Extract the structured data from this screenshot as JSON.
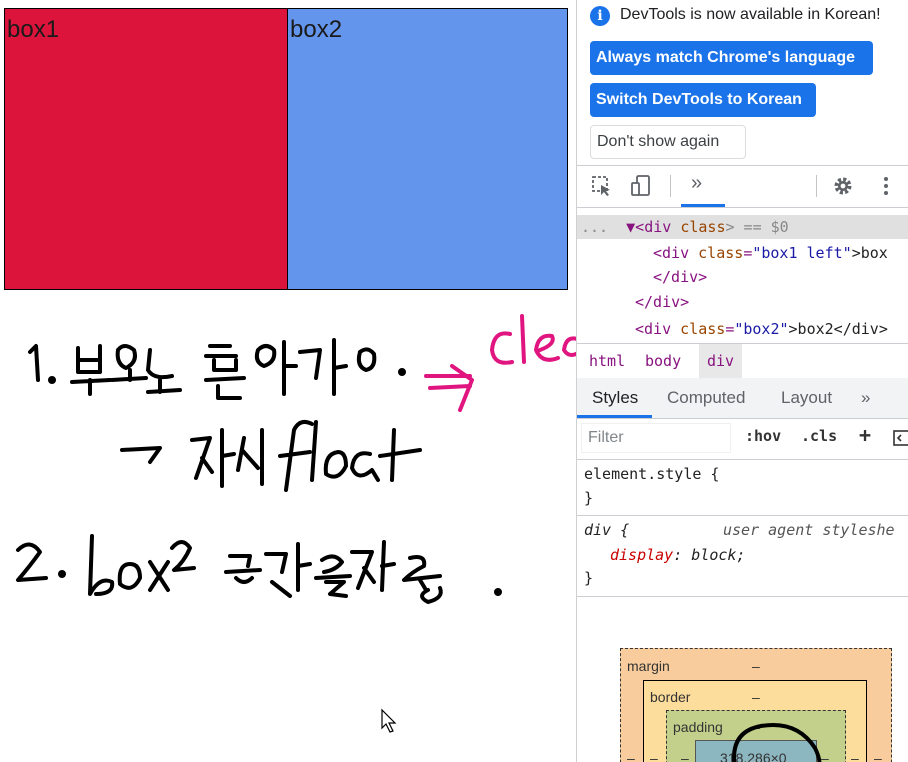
{
  "page": {
    "box1_label": "box1",
    "box2_label": "box2",
    "colors": {
      "box1": "#dc143c",
      "box2": "#6495ed"
    }
  },
  "handwriting": {
    "line1": "1. 부모요소 높이가 0.",
    "line1_arrow": "⇒ Clearing",
    "line2": "→ 자식 float",
    "line3": "2. box2 공간을 채움."
  },
  "devtools": {
    "infobar": {
      "icon": "info-icon",
      "message": "DevTools is now available in Korean!",
      "btn_match": "Always match Chrome's language",
      "btn_switch": "Switch DevTools to Korean",
      "btn_dismiss": "Don't show again"
    },
    "toolbar": {
      "inspect_icon": "inspect-element-icon",
      "device_icon": "device-toolbar-icon",
      "more_tabs": "»",
      "settings_icon": "gear-icon",
      "menu_icon": "kebab-menu-icon"
    },
    "elements": {
      "line1_dots": "...",
      "line1_tag_open": "▼<div ",
      "line1_attr": "class",
      "line1_tail": "> == $0",
      "line2_tag": "<div ",
      "line2_attr": "class",
      "line2_val": "\"box1 left\"",
      "line2_text": ">box",
      "line3": "</div>",
      "line4": "</div>",
      "line5_tag": "<div ",
      "line5_attr": "class",
      "line5_val": "\"box2\"",
      "line5_text": ">box2</div>"
    },
    "breadcrumbs": [
      "html",
      "body",
      "div"
    ],
    "subtabs": {
      "styles": "Styles",
      "computed": "Computed",
      "layout": "Layout",
      "more": "»"
    },
    "filter": {
      "placeholder": "Filter",
      "hov": ":hov",
      "cls": ".cls",
      "plus": "+"
    },
    "rules": {
      "element_style_open": "element.style {",
      "element_style_close": "}",
      "div_selector": "div {",
      "div_source": "user agent styleshe",
      "div_prop": "display",
      "div_value": "block;",
      "div_close": "}"
    },
    "boxmodel": {
      "margin_label": "margin",
      "margin_value": "–",
      "border_label": "border",
      "border_value": "–",
      "padding_label": "padding",
      "padding_value": "–",
      "content_value": "318.286×0",
      "side_dash": "–"
    }
  }
}
